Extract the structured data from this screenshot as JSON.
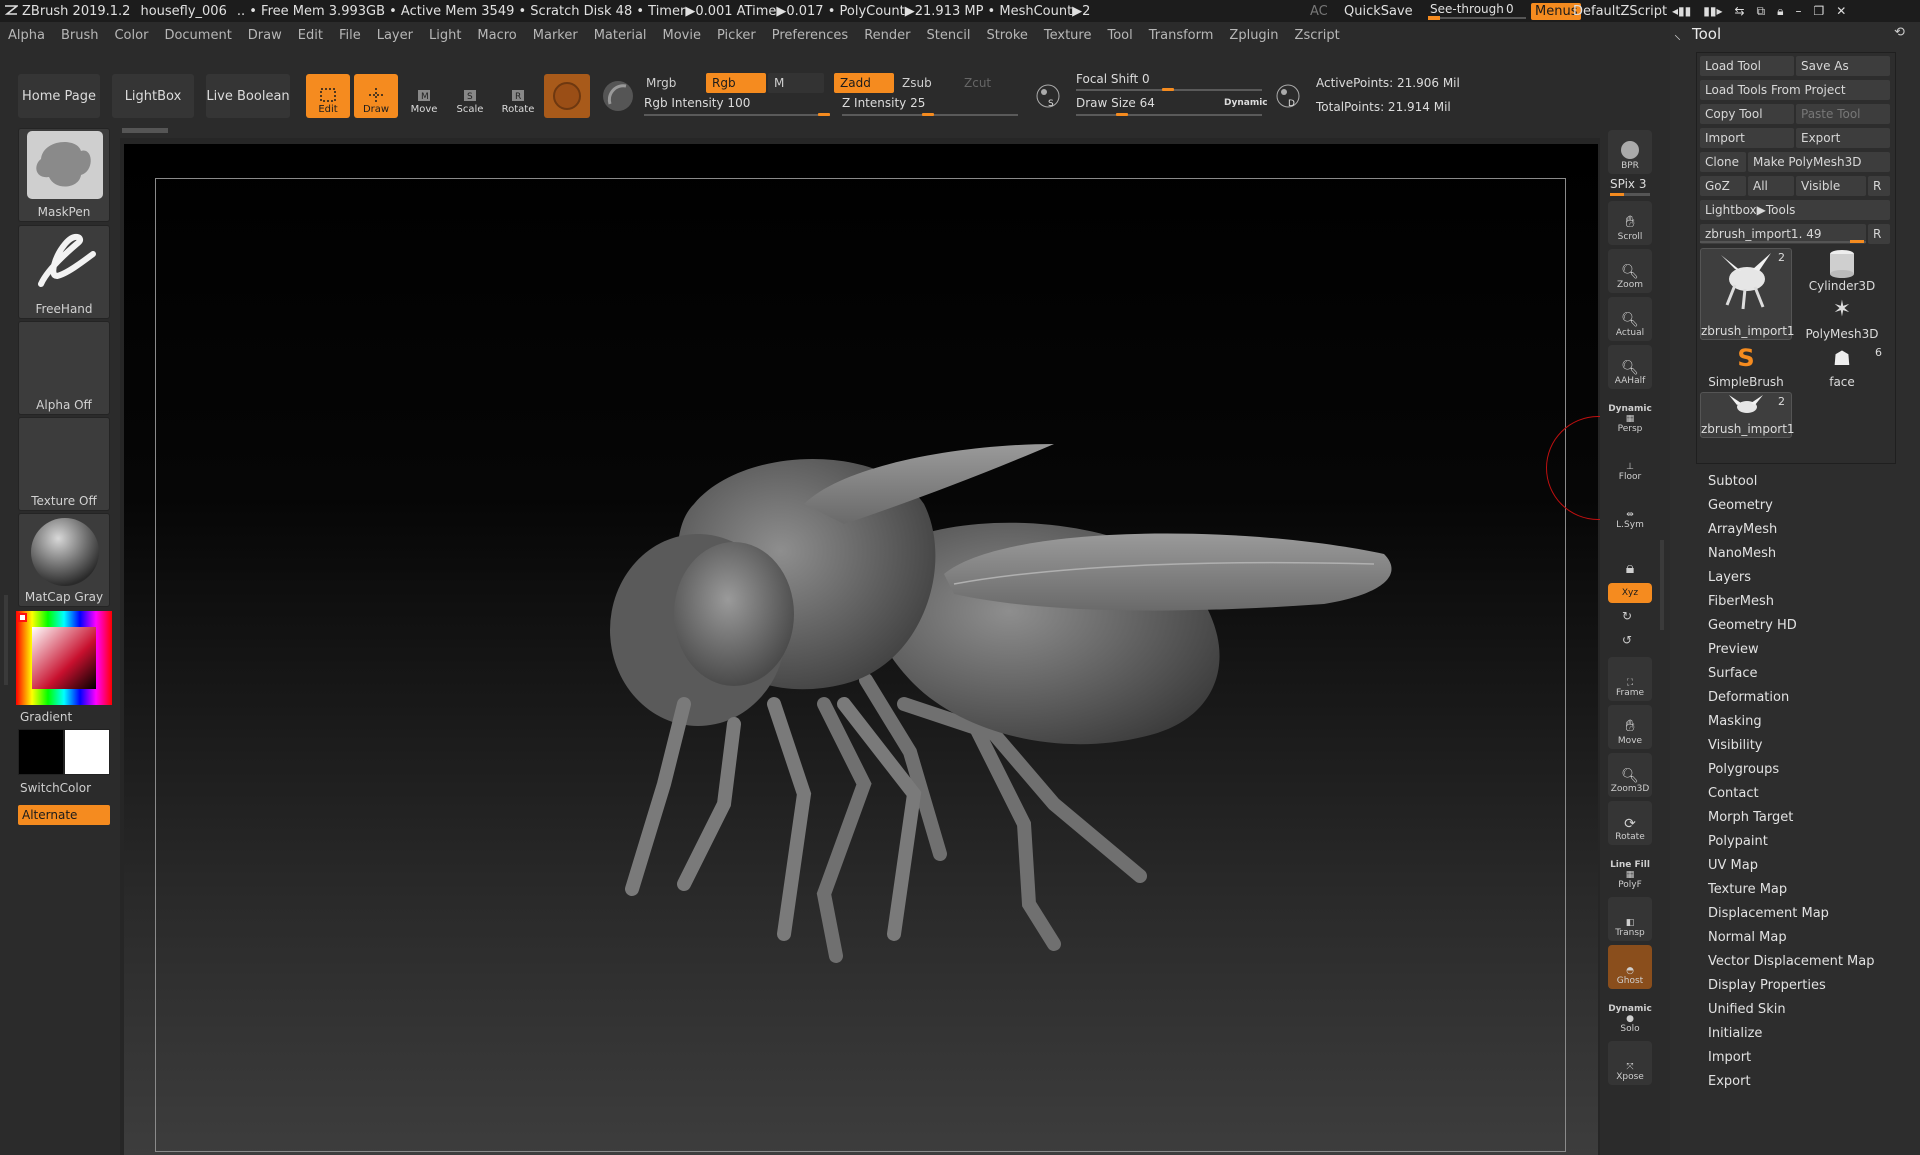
{
  "titlebar": {
    "app": "ZBrush 2019.1.2",
    "doc": "housefly_006",
    "stats": "..  • Free Mem 3.993GB • Active Mem 3549 • Scratch Disk 48 •  Timer▶0.001 ATime▶0.017 • PolyCount▶21.913 MP  • MeshCount▶2",
    "ac": "AC",
    "quicksave": "QuickSave",
    "seethrough": "See-through",
    "seethrough_value": "0",
    "menus": "Menus",
    "script": "DefaultZScript"
  },
  "menubar": [
    "Alpha",
    "Brush",
    "Color",
    "Document",
    "Draw",
    "Edit",
    "File",
    "Layer",
    "Light",
    "Macro",
    "Marker",
    "Material",
    "Movie",
    "Picker",
    "Preferences",
    "Render",
    "Stencil",
    "Stroke",
    "Texture",
    "Tool",
    "Transform",
    "Zplugin",
    "Zscript"
  ],
  "shelf": {
    "home": "Home Page",
    "lightbox": "LightBox",
    "liveboolean": "Live Boolean",
    "edit": "Edit",
    "draw": "Draw",
    "move": "Move",
    "scale": "Scale",
    "rotate": "Rotate",
    "mrgb": "Mrgb",
    "rgb": "Rgb",
    "m": "M",
    "zadd": "Zadd",
    "zsub": "Zsub",
    "zcut": "Zcut",
    "rgb_intensity": "Rgb Intensity 100",
    "rgb_intensity_value": 100,
    "z_intensity": "Z Intensity 25",
    "z_intensity_value": 25,
    "focal_shift": "Focal Shift 0",
    "draw_size": "Draw Size 64",
    "dynamic": "Dynamic",
    "active_points": "ActivePoints: 21.906 Mil",
    "total_points": "TotalPoints: 21.914 Mil"
  },
  "left": {
    "brush": "MaskPen",
    "stroke": "FreeHand",
    "alpha": "Alpha Off",
    "texture": "Texture Off",
    "material": "MatCap Gray",
    "gradient": "Gradient",
    "switchcolor": "SwitchColor",
    "alternate": "Alternate"
  },
  "rshelf": {
    "bpr": "BPR",
    "spix": "SPix 3",
    "scroll": "Scroll",
    "zoom": "Zoom",
    "actual": "Actual",
    "aahalf": "AAHalf",
    "dynamic": "Dynamic",
    "persp": "Persp",
    "floor": "Floor",
    "lsym": "L.Sym",
    "xyz": "Xyz",
    "frame": "Frame",
    "move": "Move",
    "zoom3d": "Zoom3D",
    "rotate": "Rotate",
    "linefill": "Line Fill",
    "polyf": "PolyF",
    "transp": "Transp",
    "ghost": "Ghost",
    "dynamic2": "Dynamic",
    "solo": "Solo",
    "xpose": "Xpose"
  },
  "tool": {
    "title": "Tool",
    "load_tool": "Load Tool",
    "save_as": "Save As",
    "load_from_project": "Load Tools From Project",
    "copy_tool": "Copy Tool",
    "paste_tool": "Paste Tool",
    "import": "Import",
    "export": "Export",
    "clone": "Clone",
    "make_polymesh": "Make PolyMesh3D",
    "goz": "GoZ",
    "all": "All",
    "visible": "Visible",
    "r": "R",
    "lightbox_tools": "Lightbox▶Tools",
    "current_tool": "zbrush_import1. 49",
    "thumbs": [
      {
        "label": "zbrush_import1",
        "count": "2"
      },
      {
        "label": "Cylinder3D",
        "count": ""
      },
      {
        "label": "PolyMesh3D",
        "count": ""
      },
      {
        "label": "SimpleBrush",
        "count": ""
      },
      {
        "label": "face",
        "count": "6"
      },
      {
        "label": "zbrush_import1",
        "count": "2"
      }
    ],
    "subpalettes": [
      "Subtool",
      "Geometry",
      "ArrayMesh",
      "NanoMesh",
      "Layers",
      "FiberMesh",
      "Geometry HD",
      "Preview",
      "Surface",
      "Deformation",
      "Masking",
      "Visibility",
      "Polygroups",
      "Contact",
      "Morph Target",
      "Polypaint",
      "UV Map",
      "Texture Map",
      "Displacement Map",
      "Normal Map",
      "Vector Displacement Map",
      "Display Properties",
      "Unified Skin",
      "Initialize",
      "Import",
      "Export"
    ]
  },
  "colors": {
    "accent": "#f58b1f",
    "bg": "#2b2b2b",
    "panel": "#2d2d2d"
  }
}
